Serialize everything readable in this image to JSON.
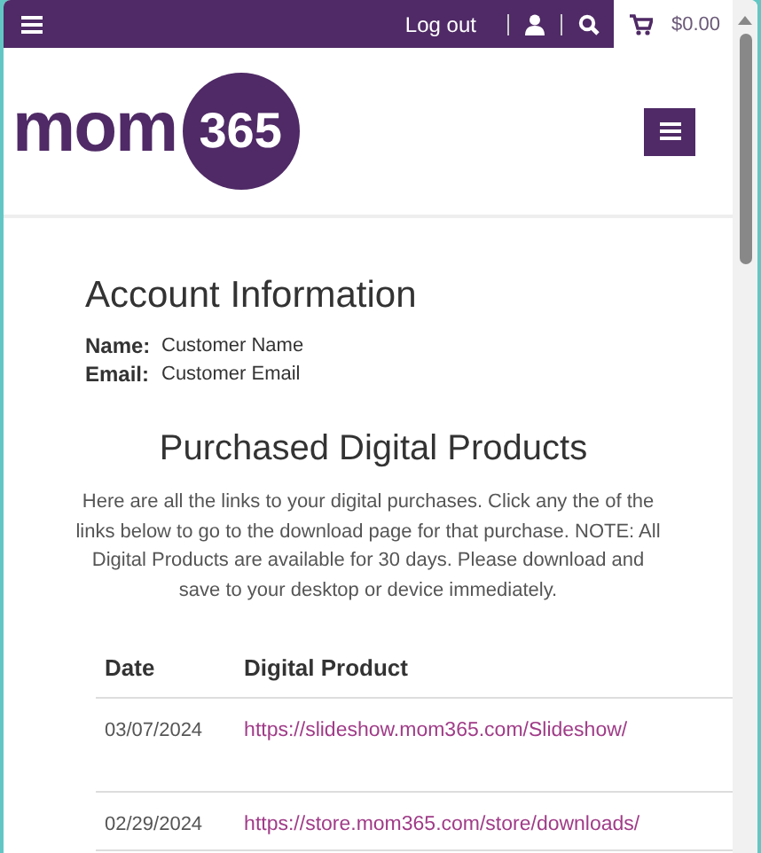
{
  "top_bar": {
    "logout": "Log out",
    "cart_total": "$0.00"
  },
  "logo": {
    "word": "mom",
    "number": "365"
  },
  "account": {
    "title": "Account Information",
    "fields": [
      {
        "label": "Name:",
        "value": "Customer Name"
      },
      {
        "label": "Email:",
        "value": "Customer Email"
      }
    ]
  },
  "purchases": {
    "title": "Purchased Digital Products",
    "intro": "Here are all the links to your digital purchases. Click any the of the links below to go to the download page for that purchase. NOTE: All Digital Products are available for 30 days. Please download and save to your desktop or device immediately.",
    "table": {
      "columns": [
        "Date",
        "Digital Product"
      ],
      "rows": [
        {
          "date": "03/07/2024",
          "link": "https://slideshow.mom365.com/Slideshow/"
        },
        {
          "date": "02/29/2024",
          "link": "https://store.mom365.com/store/downloads/"
        }
      ]
    }
  }
}
